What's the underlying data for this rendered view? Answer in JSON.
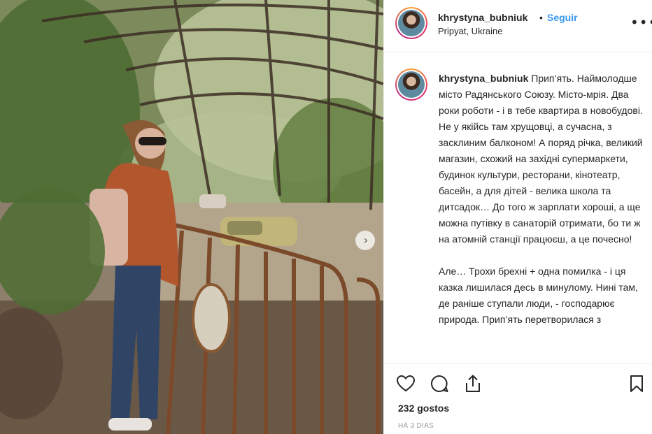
{
  "post": {
    "image_alt": "Woman with backpack standing by rusty fence at abandoned bumper car rink, Pripyat",
    "next_icon": "chevron-right-icon"
  },
  "header": {
    "username": "khrystyna_bubniuk",
    "separator": "•",
    "follow_label": "Seguir",
    "location": "Pripyat, Ukraine",
    "more_label": "•••"
  },
  "caption": {
    "username": "khrystyna_bubniuk",
    "text": " Прип’ять. Наймолодше місто Радянського Союзу. Місто-мрія. Два роки роботи - і в тебе квартира в новобудові. Не у якійсь там хрущовці, а сучасна, з засклиним балконом! А поряд річка, великий магазин, схожий на західні супермаркети, будинок культури, ресторани, кінотеатр, басейн, а для дітей - велика школа та дитсадок… До того ж зарплати хороші, а ще можна путівку в санаторій отримати, бо ти ж на атомній станції працюєш, а це почесно!\n\nАле… Трохи брехні + одна помилка - і ця казка лишилася десь в минулому. Нині там, де раніше ступали люди, - господарює природа. Прип’ять перетворилася з"
  },
  "actions": {
    "like_icon": "heart-icon",
    "comment_icon": "comment-icon",
    "share_icon": "share-icon",
    "save_icon": "bookmark-icon",
    "likes_text": "232 gostos",
    "time_text": "HÁ 3 DIAS"
  },
  "colors": {
    "link_blue": "#3897f0",
    "text": "#262626",
    "muted": "#999999",
    "border": "#efefef"
  }
}
